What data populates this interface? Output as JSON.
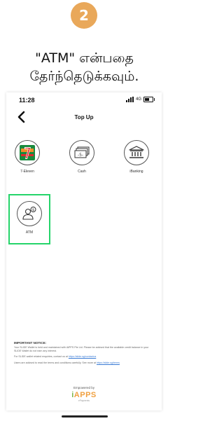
{
  "step": {
    "number": "2",
    "color": "#e9a85a"
  },
  "instruction": {
    "line1": "\"ATM\" என்பதை",
    "line2": "தேர்ந்தெடுக்கவும்."
  },
  "status_bar": {
    "time": "11:28",
    "network": "4G"
  },
  "nav": {
    "title": "Top Up"
  },
  "options": [
    {
      "label": "7-Eleven",
      "icon": "7-eleven-logo-icon"
    },
    {
      "label": "Cash",
      "icon": "cash-icon"
    },
    {
      "label": "iBanking",
      "icon": "bank-icon"
    },
    {
      "label": "ATM",
      "icon": "atm-user-icon",
      "highlighted": true
    }
  ],
  "highlight_color": "#25d46a",
  "notice": {
    "title": "IMPORTANT NOTICE:",
    "p1": "Your SLIDE Wallet is held and maintained with iAPPS Pte Ltd. Please be advised that the available credit balance in your SLIDE Wallet do not earn any interest.",
    "p2_text": "For SLIDE wallet related enquiries, contact us at",
    "p2_link": "https://slide.sg/contactus",
    "p3_text": "Users are advised to read the terms and conditions carefully. See more at",
    "p3_link": "https://slide.sg/terms"
  },
  "powered_by": {
    "label": "Empowered by",
    "logo_i": "i",
    "logo_rest": "APPS",
    "tagline": "ePayments"
  }
}
